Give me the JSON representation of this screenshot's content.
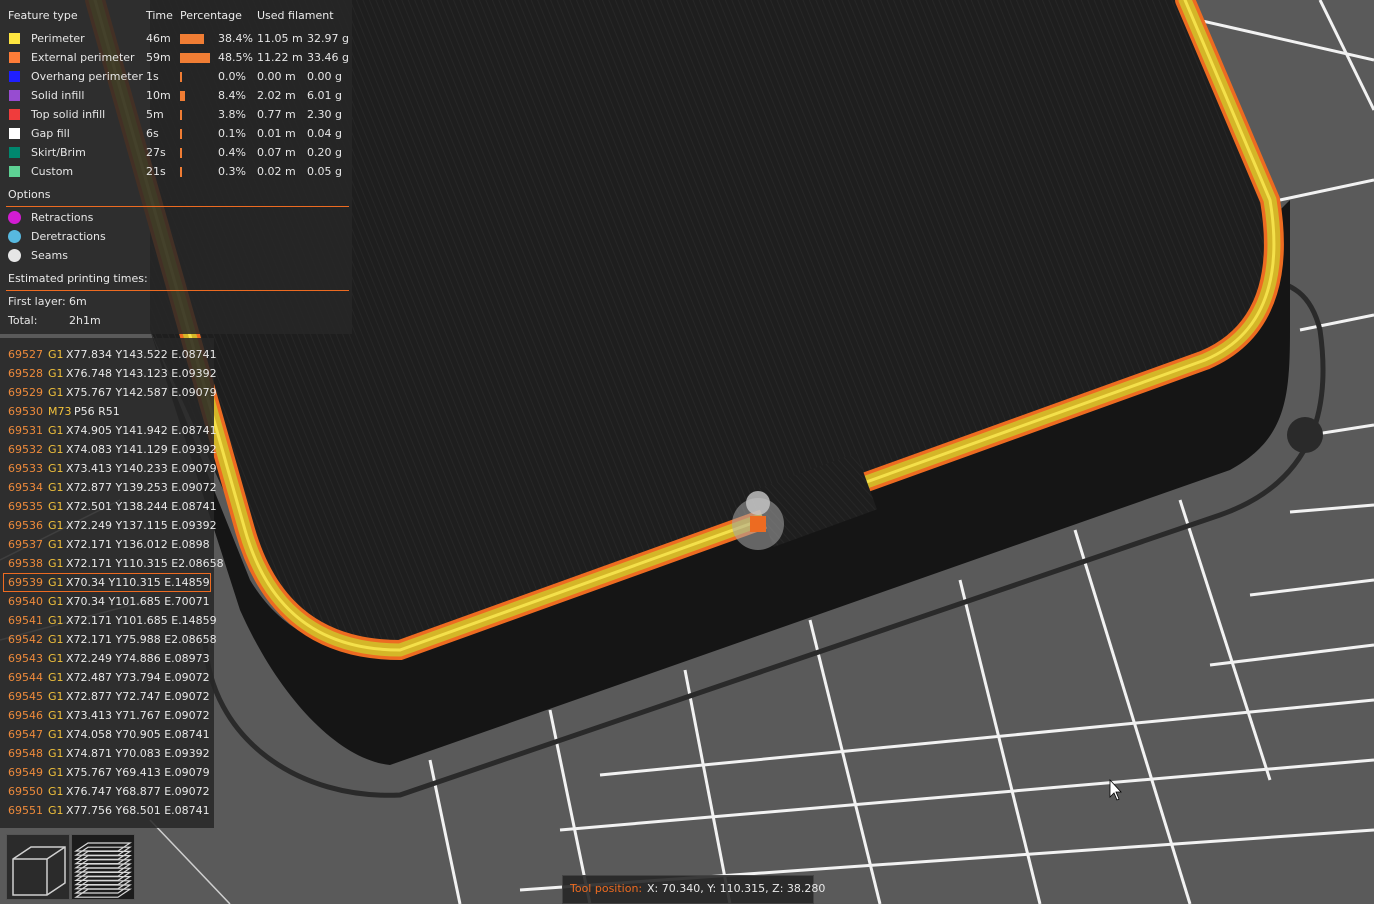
{
  "legend": {
    "headers": {
      "feature": "Feature type",
      "time": "Time",
      "percentage": "Percentage",
      "filament": "Used filament"
    },
    "features": [
      {
        "name": "Perimeter",
        "color": "#ffe640",
        "time": "46m",
        "pct": "38.4%",
        "pct_value": 38.4,
        "length": "11.05 m",
        "weight": "32.97 g"
      },
      {
        "name": "External perimeter",
        "color": "#ff7d38",
        "time": "59m",
        "pct": "48.5%",
        "pct_value": 48.5,
        "length": "11.22 m",
        "weight": "33.46 g"
      },
      {
        "name": "Overhang perimeter",
        "color": "#1f1fff",
        "time": "1s",
        "pct": "0.0%",
        "pct_value": 0.0,
        "length": "0.00 m",
        "weight": "0.00 g"
      },
      {
        "name": "Solid infill",
        "color": "#974cd1",
        "time": "10m",
        "pct": "8.4%",
        "pct_value": 8.4,
        "length": "2.02 m",
        "weight": "6.01 g"
      },
      {
        "name": "Top solid infill",
        "color": "#f03c3c",
        "time": "5m",
        "pct": "3.8%",
        "pct_value": 3.8,
        "length": "0.77 m",
        "weight": "2.30 g"
      },
      {
        "name": "Gap fill",
        "color": "#ffffff",
        "time": "6s",
        "pct": "0.1%",
        "pct_value": 0.1,
        "length": "0.01 m",
        "weight": "0.04 g"
      },
      {
        "name": "Skirt/Brim",
        "color": "#00876e",
        "time": "27s",
        "pct": "0.4%",
        "pct_value": 0.4,
        "length": "0.07 m",
        "weight": "0.20 g"
      },
      {
        "name": "Custom",
        "color": "#5ed194",
        "time": "21s",
        "pct": "0.3%",
        "pct_value": 0.3,
        "length": "0.02 m",
        "weight": "0.05 g"
      }
    ],
    "options_title": "Options",
    "options": [
      {
        "name": "Retractions",
        "color": "#d21cd2"
      },
      {
        "name": "Deretractions",
        "color": "#57b9e0"
      },
      {
        "name": "Seams",
        "color": "#e6e6e6"
      }
    ],
    "times_title": "Estimated printing times:",
    "first_layer_label": "First layer:",
    "first_layer_value": "6m",
    "total_label": "Total:",
    "total_value": "2h1m"
  },
  "gcode": [
    {
      "n": "69527",
      "c": "G1",
      "a": "X77.834 Y143.522 E.08741"
    },
    {
      "n": "69528",
      "c": "G1",
      "a": "X76.748 Y143.123 E.09392"
    },
    {
      "n": "69529",
      "c": "G1",
      "a": "X75.767 Y142.587 E.09079"
    },
    {
      "n": "69530",
      "c": "M73",
      "a": "P56 R51"
    },
    {
      "n": "69531",
      "c": "G1",
      "a": "X74.905 Y141.942 E.08741"
    },
    {
      "n": "69532",
      "c": "G1",
      "a": "X74.083 Y141.129 E.09392"
    },
    {
      "n": "69533",
      "c": "G1",
      "a": "X73.413 Y140.233 E.09079"
    },
    {
      "n": "69534",
      "c": "G1",
      "a": "X72.877 Y139.253 E.09072"
    },
    {
      "n": "69535",
      "c": "G1",
      "a": "X72.501 Y138.244 E.08741"
    },
    {
      "n": "69536",
      "c": "G1",
      "a": "X72.249 Y137.115 E.09392"
    },
    {
      "n": "69537",
      "c": "G1",
      "a": "X72.171 Y136.012 E.0898"
    },
    {
      "n": "69538",
      "c": "G1",
      "a": "X72.171 Y110.315 E2.08658"
    },
    {
      "n": "69539",
      "c": "G1",
      "a": "X70.34 Y110.315 E.14859"
    },
    {
      "n": "69540",
      "c": "G1",
      "a": "X70.34 Y101.685 E.70071"
    },
    {
      "n": "69541",
      "c": "G1",
      "a": "X72.171 Y101.685 E.14859"
    },
    {
      "n": "69542",
      "c": "G1",
      "a": "X72.171 Y75.988 E2.08658"
    },
    {
      "n": "69543",
      "c": "G1",
      "a": "X72.249 Y74.886 E.08973"
    },
    {
      "n": "69544",
      "c": "G1",
      "a": "X72.487 Y73.794 E.09072"
    },
    {
      "n": "69545",
      "c": "G1",
      "a": "X72.877 Y72.747 E.09072"
    },
    {
      "n": "69546",
      "c": "G1",
      "a": "X73.413 Y71.767 E.09072"
    },
    {
      "n": "69547",
      "c": "G1",
      "a": "X74.058 Y70.905 E.08741"
    },
    {
      "n": "69548",
      "c": "G1",
      "a": "X74.871 Y70.083 E.09392"
    },
    {
      "n": "69549",
      "c": "G1",
      "a": "X75.767 Y69.413 E.09079"
    },
    {
      "n": "69550",
      "c": "G1",
      "a": "X76.747 Y68.877 E.09072"
    },
    {
      "n": "69551",
      "c": "G1",
      "a": "X77.756 Y68.501 E.08741"
    }
  ],
  "selected_line": "69539",
  "tool_position": {
    "label": "Tool position:",
    "value": "X: 70.340, Y: 110.315, Z: 38.280"
  },
  "colors": {
    "accent": "#ed6b21",
    "bed": "#5a5a5a",
    "object": "#1b1b1b"
  }
}
